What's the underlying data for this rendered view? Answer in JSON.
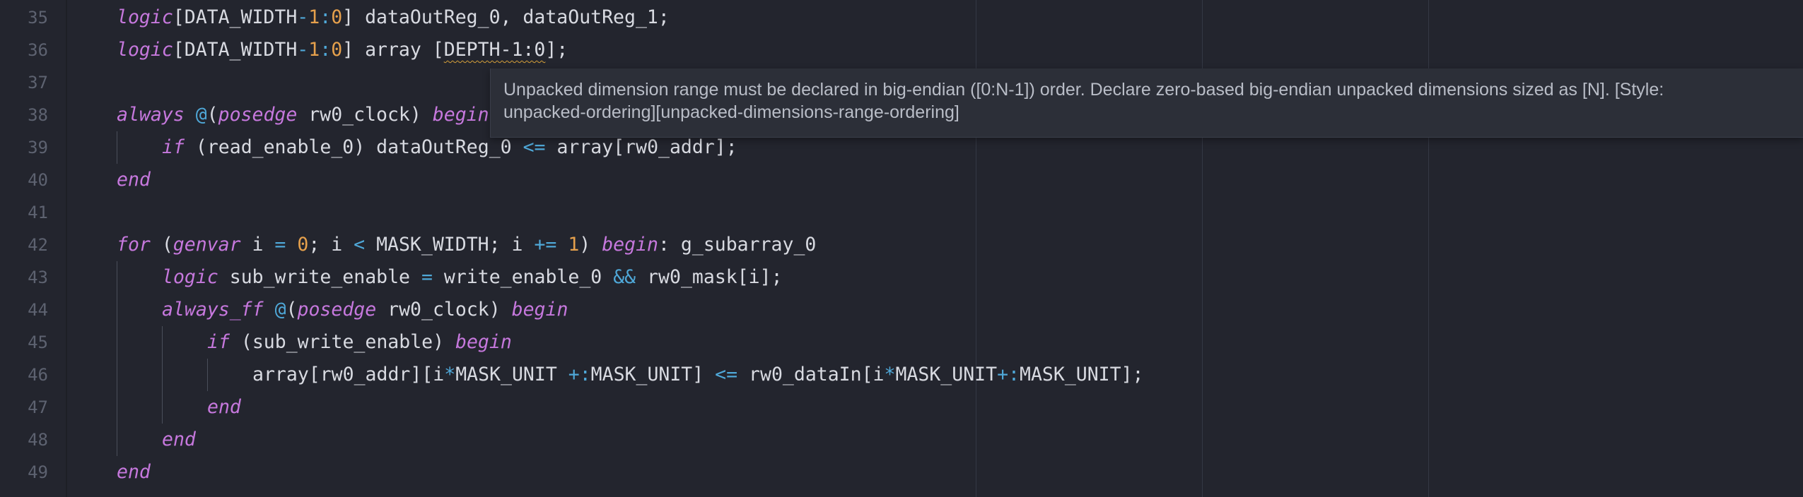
{
  "editor": {
    "line_numbers": [
      "35",
      "36",
      "37",
      "38",
      "39",
      "40",
      "41",
      "42",
      "43",
      "44",
      "45",
      "46",
      "47",
      "48",
      "49"
    ],
    "lines": [
      [
        [
          "logic",
          "kw"
        ],
        [
          "[DATA_WIDTH",
          "id"
        ],
        [
          "-",
          "op"
        ],
        [
          "1",
          "num"
        ],
        [
          ":",
          "op"
        ],
        [
          "0",
          "num"
        ],
        [
          "] dataOutReg_0, dataOutReg_1;",
          "id"
        ]
      ],
      [
        [
          "logic",
          "kw"
        ],
        [
          "[DATA_WIDTH",
          "id"
        ],
        [
          "-",
          "op"
        ],
        [
          "1",
          "num"
        ],
        [
          ":",
          "op"
        ],
        [
          "0",
          "num"
        ],
        [
          "] array [",
          "id"
        ],
        [
          "DEPTH-1:0",
          "squig"
        ],
        [
          "];",
          "id"
        ]
      ],
      [],
      [
        [
          "always",
          "kw"
        ],
        [
          " ",
          "id"
        ],
        [
          "@",
          "op"
        ],
        [
          "(",
          "id"
        ],
        [
          "posedge",
          "kw"
        ],
        [
          " rw0_clock) ",
          "id"
        ],
        [
          "begin",
          "kw"
        ]
      ],
      [
        [
          "if",
          "kw"
        ],
        [
          " (read_enable_0) dataOutReg_0 ",
          "id"
        ],
        [
          "<=",
          "op"
        ],
        [
          " array[rw0_addr];",
          "id"
        ]
      ],
      [
        [
          "end",
          "kw"
        ]
      ],
      [],
      [
        [
          "for",
          "kw"
        ],
        [
          " (",
          "id"
        ],
        [
          "genvar",
          "kw"
        ],
        [
          " i ",
          "id"
        ],
        [
          "=",
          "op"
        ],
        [
          " ",
          "id"
        ],
        [
          "0",
          "num"
        ],
        [
          "; i ",
          "id"
        ],
        [
          "<",
          "op"
        ],
        [
          " MASK_WIDTH; i ",
          "id"
        ],
        [
          "+=",
          "op"
        ],
        [
          " ",
          "id"
        ],
        [
          "1",
          "num"
        ],
        [
          ") ",
          "id"
        ],
        [
          "begin",
          "kw"
        ],
        [
          ": g_subarray_0",
          "id"
        ]
      ],
      [
        [
          "logic",
          "kw"
        ],
        [
          " sub_write_enable ",
          "id"
        ],
        [
          "=",
          "op"
        ],
        [
          " write_enable_0 ",
          "id"
        ],
        [
          "&&",
          "op"
        ],
        [
          " rw0_mask[i];",
          "id"
        ]
      ],
      [
        [
          "always_ff",
          "kw"
        ],
        [
          " ",
          "id"
        ],
        [
          "@",
          "op"
        ],
        [
          "(",
          "id"
        ],
        [
          "posedge",
          "kw"
        ],
        [
          " rw0_clock) ",
          "id"
        ],
        [
          "begin",
          "kw"
        ]
      ],
      [
        [
          "if",
          "kw"
        ],
        [
          " (sub_write_enable) ",
          "id"
        ],
        [
          "begin",
          "kw"
        ]
      ],
      [
        [
          "array[rw0_addr][i",
          "id"
        ],
        [
          "*",
          "op"
        ],
        [
          "MASK_UNIT ",
          "id"
        ],
        [
          "+:",
          "op"
        ],
        [
          "MASK_UNIT] ",
          "id"
        ],
        [
          "<=",
          "op"
        ],
        [
          " rw0_dataIn[i",
          "id"
        ],
        [
          "*",
          "op"
        ],
        [
          "MASK_UNIT",
          "id"
        ],
        [
          "+:",
          "op"
        ],
        [
          "MASK_UNIT];",
          "id"
        ]
      ],
      [
        [
          "end",
          "kw"
        ]
      ],
      [
        [
          "end",
          "kw"
        ]
      ],
      [
        [
          "end",
          "kw"
        ]
      ]
    ],
    "indents": [
      1,
      1,
      0,
      1,
      2,
      1,
      0,
      1,
      2,
      2,
      3,
      4,
      3,
      2,
      1
    ]
  },
  "diagnostic": {
    "line1": "Unpacked dimension range must be declared in big-endian ([0:N-1]) order. Declare zero-based big-endian unpacked dimensions sized as [N]. [Style:",
    "line2": "unpacked-ordering][unpacked-dimensions-range-ordering]"
  },
  "colors": {
    "background": "#23252e",
    "keyword": "#c678dd",
    "number": "#e5a04c",
    "operator": "#4fa8d8",
    "identifier": "#d8dae1",
    "line_number": "#5d6270",
    "warning_squiggle": "#d7a13a",
    "tooltip_bg": "#2c2f38",
    "tooltip_text": "#b9bdc7"
  }
}
